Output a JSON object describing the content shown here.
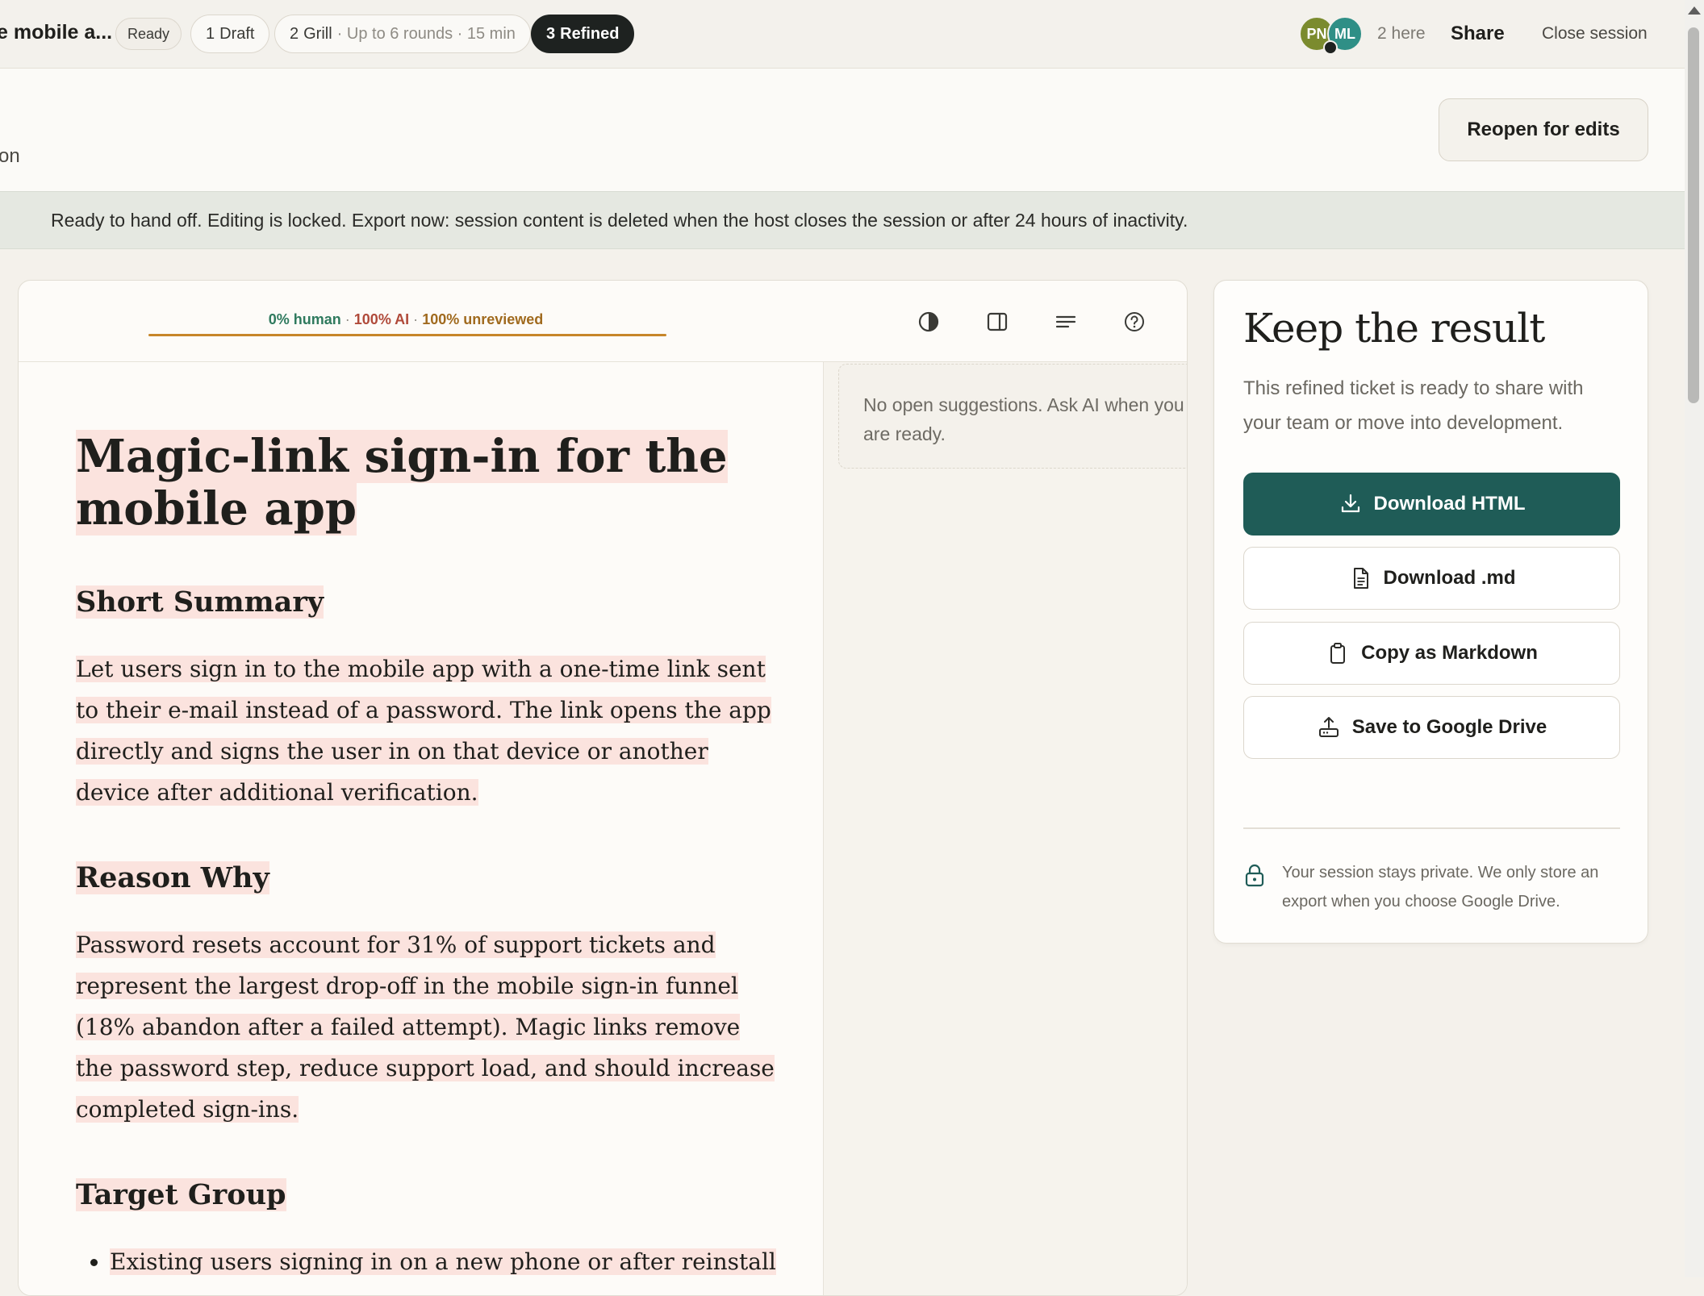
{
  "header": {
    "doc_title": "e mobile a...",
    "status": "Ready",
    "steps": [
      {
        "num": "1",
        "label": "Draft",
        "detail": ""
      },
      {
        "num": "2",
        "label": "Grill",
        "detail": "· Up to 6 rounds · 15 min"
      },
      {
        "num": "3",
        "label": "Refined",
        "detail": ""
      }
    ],
    "avatars": [
      "PN",
      "ML"
    ],
    "presence": "2 here",
    "share_label": "Share",
    "close_label": "Close session"
  },
  "subheader": {
    "fragment": "on",
    "reopen_label": "Reopen for edits"
  },
  "banner": "Ready to hand off. Editing is locked. Export now: session content is deleted when the host closes the session or after 24 hours of inactivity.",
  "editor": {
    "stats": {
      "human": "0% human",
      "ai": "100% AI",
      "unreviewed": "100% unreviewed",
      "sep": "·"
    },
    "toolbar_icons": [
      "contrast-icon",
      "split-panel-icon",
      "lines-icon",
      "help-icon"
    ],
    "doc": {
      "title": "Magic-link sign-in for the mobile app",
      "sections": [
        {
          "heading": "Short Summary",
          "body": "Let users sign in to the mobile app with a one-time link sent to their e-mail instead of a password. The link opens the app directly and signs the user in on that device or another device after additional verification."
        },
        {
          "heading": "Reason Why",
          "body": "Password resets account for 31% of support tickets and represent the largest drop-off in the mobile sign-in funnel (18% abandon after a failed attempt). Magic links remove the password step, reduce support load, and should increase completed sign-ins."
        },
        {
          "heading": "Target Group",
          "items": [
            "Existing users signing in on a new phone or after reinstall"
          ]
        }
      ]
    },
    "suggestions_empty": "No open suggestions. Ask AI when you are ready."
  },
  "keep": {
    "title": "Keep the result",
    "description": "This refined ticket is ready to share with your team or move into development.",
    "buttons": [
      {
        "label": "Download HTML",
        "icon": "download-icon"
      },
      {
        "label": "Download .md",
        "icon": "file-icon"
      },
      {
        "label": "Copy as Markdown",
        "icon": "clipboard-icon"
      },
      {
        "label": "Save to Google Drive",
        "icon": "upload-drive-icon"
      }
    ],
    "privacy": "Your session stays private. We only store an export when you choose Google Drive."
  },
  "colors": {
    "accent": "#1f5c57",
    "highlight": "#fbe3de",
    "active_step": "#1e2220",
    "human": "#2f7a5e",
    "ai": "#b04a3a",
    "unreviewed": "#a06a1e"
  }
}
